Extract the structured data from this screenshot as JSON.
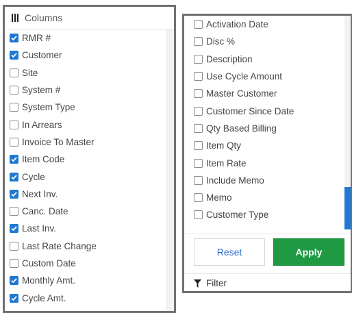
{
  "left_panel": {
    "header": "Columns",
    "items": [
      {
        "label": "RMR #",
        "checked": true
      },
      {
        "label": "Customer",
        "checked": true
      },
      {
        "label": "Site",
        "checked": false
      },
      {
        "label": "System #",
        "checked": false
      },
      {
        "label": "System Type",
        "checked": false
      },
      {
        "label": "In Arrears",
        "checked": false
      },
      {
        "label": "Invoice To Master",
        "checked": false
      },
      {
        "label": "Item Code",
        "checked": true
      },
      {
        "label": "Cycle",
        "checked": true
      },
      {
        "label": "Next Inv.",
        "checked": true
      },
      {
        "label": "Canc. Date",
        "checked": false
      },
      {
        "label": "Last Inv.",
        "checked": true
      },
      {
        "label": "Last Rate Change",
        "checked": false
      },
      {
        "label": "Custom Date",
        "checked": false
      },
      {
        "label": "Monthly Amt.",
        "checked": true
      },
      {
        "label": "Cycle Amt.",
        "checked": true
      }
    ]
  },
  "right_panel": {
    "items": [
      {
        "label": "Activation Date",
        "checked": false
      },
      {
        "label": "Disc %",
        "checked": false
      },
      {
        "label": "Description",
        "checked": false
      },
      {
        "label": "Use Cycle Amount",
        "checked": false
      },
      {
        "label": "Master Customer",
        "checked": false
      },
      {
        "label": "Customer Since Date",
        "checked": false
      },
      {
        "label": "Qty Based Billing",
        "checked": false
      },
      {
        "label": "Item Qty",
        "checked": false
      },
      {
        "label": "Item Rate",
        "checked": false
      },
      {
        "label": "Include Memo",
        "checked": false
      },
      {
        "label": "Memo",
        "checked": false
      },
      {
        "label": "Customer Type",
        "checked": false
      }
    ],
    "reset_label": "Reset",
    "apply_label": "Apply",
    "filter_label": "Filter"
  },
  "colors": {
    "checkbox_checked": "#1f78d1",
    "apply_button": "#1f9a43",
    "reset_text": "#2b6ccc",
    "scroll_thumb": "#1f78d1"
  },
  "icons": {
    "header": "columns-icon",
    "filter": "filter-icon",
    "check": "checkmark-icon"
  }
}
